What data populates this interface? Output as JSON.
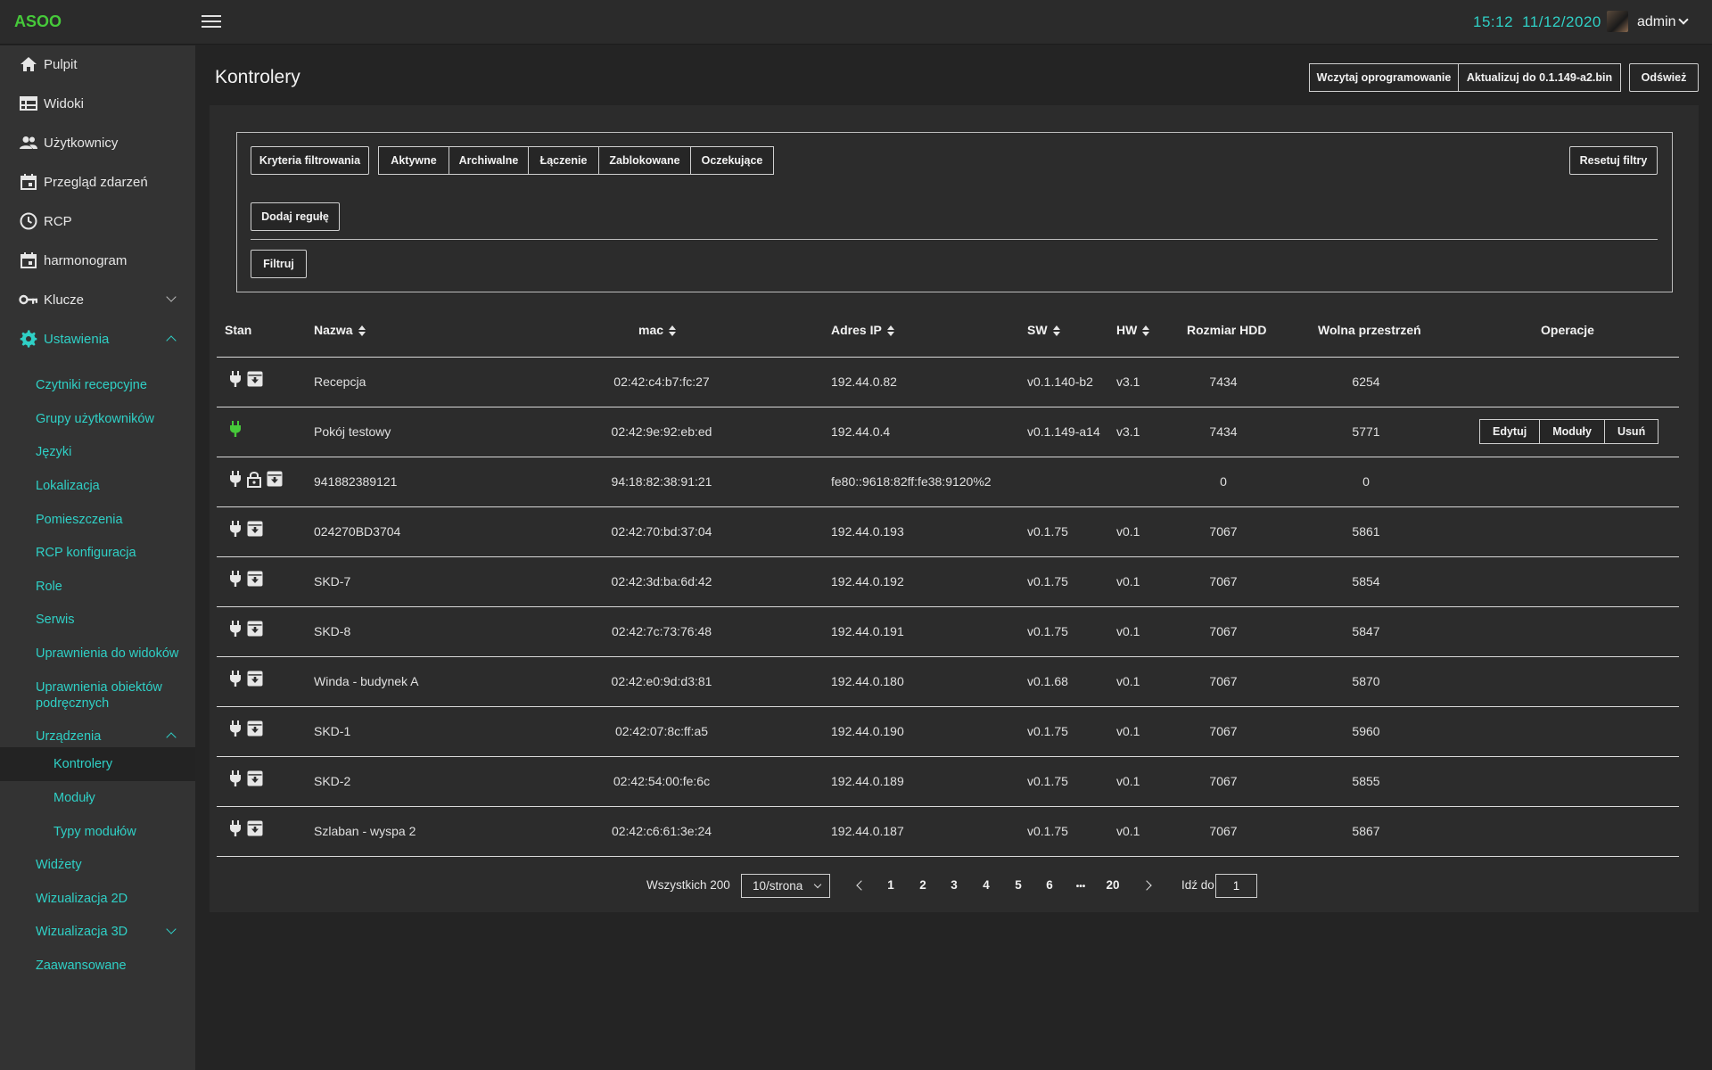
{
  "app": {
    "logo": "ASOO",
    "time": "15:12",
    "date": "11/12/2020",
    "user": "admin"
  },
  "colors": {
    "accent": "#2fd0c6",
    "logo": "#46c93a",
    "online": "#46c93a"
  },
  "sidebar": {
    "items": [
      {
        "label": "Pulpit",
        "icon": "home-icon"
      },
      {
        "label": "Widoki",
        "icon": "table-icon"
      },
      {
        "label": "Użytkownicy",
        "icon": "users-icon"
      },
      {
        "label": "Przegląd zdarzeń",
        "icon": "calendar-icon"
      },
      {
        "label": "RCP",
        "icon": "clock-icon"
      },
      {
        "label": "harmonogram",
        "icon": "calendar-icon"
      },
      {
        "label": "Klucze",
        "icon": "key-icon"
      },
      {
        "label": "Ustawienia",
        "icon": "gear-icon"
      }
    ],
    "settings": [
      "Czytniki recepcyjne",
      "Grupy użytkowników",
      "Języki",
      "Lokalizacja",
      "Pomieszczenia",
      "RCP konfiguracja",
      "Role",
      "Serwis",
      "Uprawnienia do widoków",
      "Uprawnienia obiektów podręcznych",
      "Urządzenia"
    ],
    "devices": [
      "Kontrolery",
      "Moduły",
      "Typy modułów"
    ],
    "after": [
      "Widżety",
      "Wizualizacja 2D",
      "Wizualizacja 3D",
      "Zaawansowane"
    ]
  },
  "page": {
    "title": "Kontrolery",
    "load_firmware": "Wczytaj oprogramowanie",
    "update_to": "Aktualizuj do 0.1.149-a2.bin",
    "refresh": "Odśwież"
  },
  "filters": {
    "criteria": "Kryteria filtrowania",
    "tabs": [
      "Aktywne",
      "Archiwalne",
      "Łączenie",
      "Zablokowane",
      "Oczekujące"
    ],
    "reset": "Resetuj filtry",
    "add_rule": "Dodaj regułę",
    "apply": "Filtruj"
  },
  "table": {
    "headers": [
      "Stan",
      "Nazwa",
      "mac",
      "Adres IP",
      "SW",
      "HW",
      "Rozmiar HDD",
      "Wolna przestrzeń",
      "Operacje"
    ],
    "rows": [
      {
        "state": [
          "plug-icon",
          "archive-icon"
        ],
        "name": "Recepcja",
        "mac": "02:42:c4:b7:fc:27",
        "ip": "192.44.0.82",
        "sw": "v0.1.140-b2",
        "hw": "v3.1",
        "hdd": "7434",
        "free": "6254"
      },
      {
        "state": [
          "plug-online-icon"
        ],
        "name": "Pokój testowy",
        "mac": "02:42:9e:92:eb:ed",
        "ip": "192.44.0.4",
        "sw": "v0.1.149-a14",
        "hw": "v3.1",
        "hdd": "7434",
        "free": "5771",
        "ops": [
          "Edytuj",
          "Moduły",
          "Usuń"
        ]
      },
      {
        "state": [
          "plug-icon",
          "lock-icon",
          "archive-icon"
        ],
        "name": "941882389121",
        "mac": "94:18:82:38:91:21",
        "ip": "fe80::9618:82ff:fe38:9120%2",
        "sw": "",
        "hw": "",
        "hdd": "0",
        "free": "0"
      },
      {
        "state": [
          "plug-icon",
          "archive-icon"
        ],
        "name": "024270BD3704",
        "mac": "02:42:70:bd:37:04",
        "ip": "192.44.0.193",
        "sw": "v0.1.75",
        "hw": "v0.1",
        "hdd": "7067",
        "free": "5861"
      },
      {
        "state": [
          "plug-icon",
          "archive-icon"
        ],
        "name": "SKD-7",
        "mac": "02:42:3d:ba:6d:42",
        "ip": "192.44.0.192",
        "sw": "v0.1.75",
        "hw": "v0.1",
        "hdd": "7067",
        "free": "5854"
      },
      {
        "state": [
          "plug-icon",
          "archive-icon"
        ],
        "name": "SKD-8",
        "mac": "02:42:7c:73:76:48",
        "ip": "192.44.0.191",
        "sw": "v0.1.75",
        "hw": "v0.1",
        "hdd": "7067",
        "free": "5847"
      },
      {
        "state": [
          "plug-icon",
          "archive-icon"
        ],
        "name": "Winda - budynek A",
        "mac": "02:42:e0:9d:d3:81",
        "ip": "192.44.0.180",
        "sw": "v0.1.68",
        "hw": "v0.1",
        "hdd": "7067",
        "free": "5870"
      },
      {
        "state": [
          "plug-icon",
          "archive-icon"
        ],
        "name": "SKD-1",
        "mac": "02:42:07:8c:ff:a5",
        "ip": "192.44.0.190",
        "sw": "v0.1.75",
        "hw": "v0.1",
        "hdd": "7067",
        "free": "5960"
      },
      {
        "state": [
          "plug-icon",
          "archive-icon"
        ],
        "name": "SKD-2",
        "mac": "02:42:54:00:fe:6c",
        "ip": "192.44.0.189",
        "sw": "v0.1.75",
        "hw": "v0.1",
        "hdd": "7067",
        "free": "5855"
      },
      {
        "state": [
          "plug-icon",
          "archive-icon"
        ],
        "name": "Szlaban - wyspa 2",
        "mac": "02:42:c6:61:3e:24",
        "ip": "192.44.0.187",
        "sw": "v0.1.75",
        "hw": "v0.1",
        "hdd": "7067",
        "free": "5867"
      }
    ]
  },
  "pagination": {
    "total": "Wszystkich 200",
    "per_page": "10/strona",
    "pages": [
      "1",
      "2",
      "3",
      "4",
      "5",
      "6",
      "•••",
      "20"
    ],
    "goto_label": "Idź do",
    "goto_value": "1"
  }
}
